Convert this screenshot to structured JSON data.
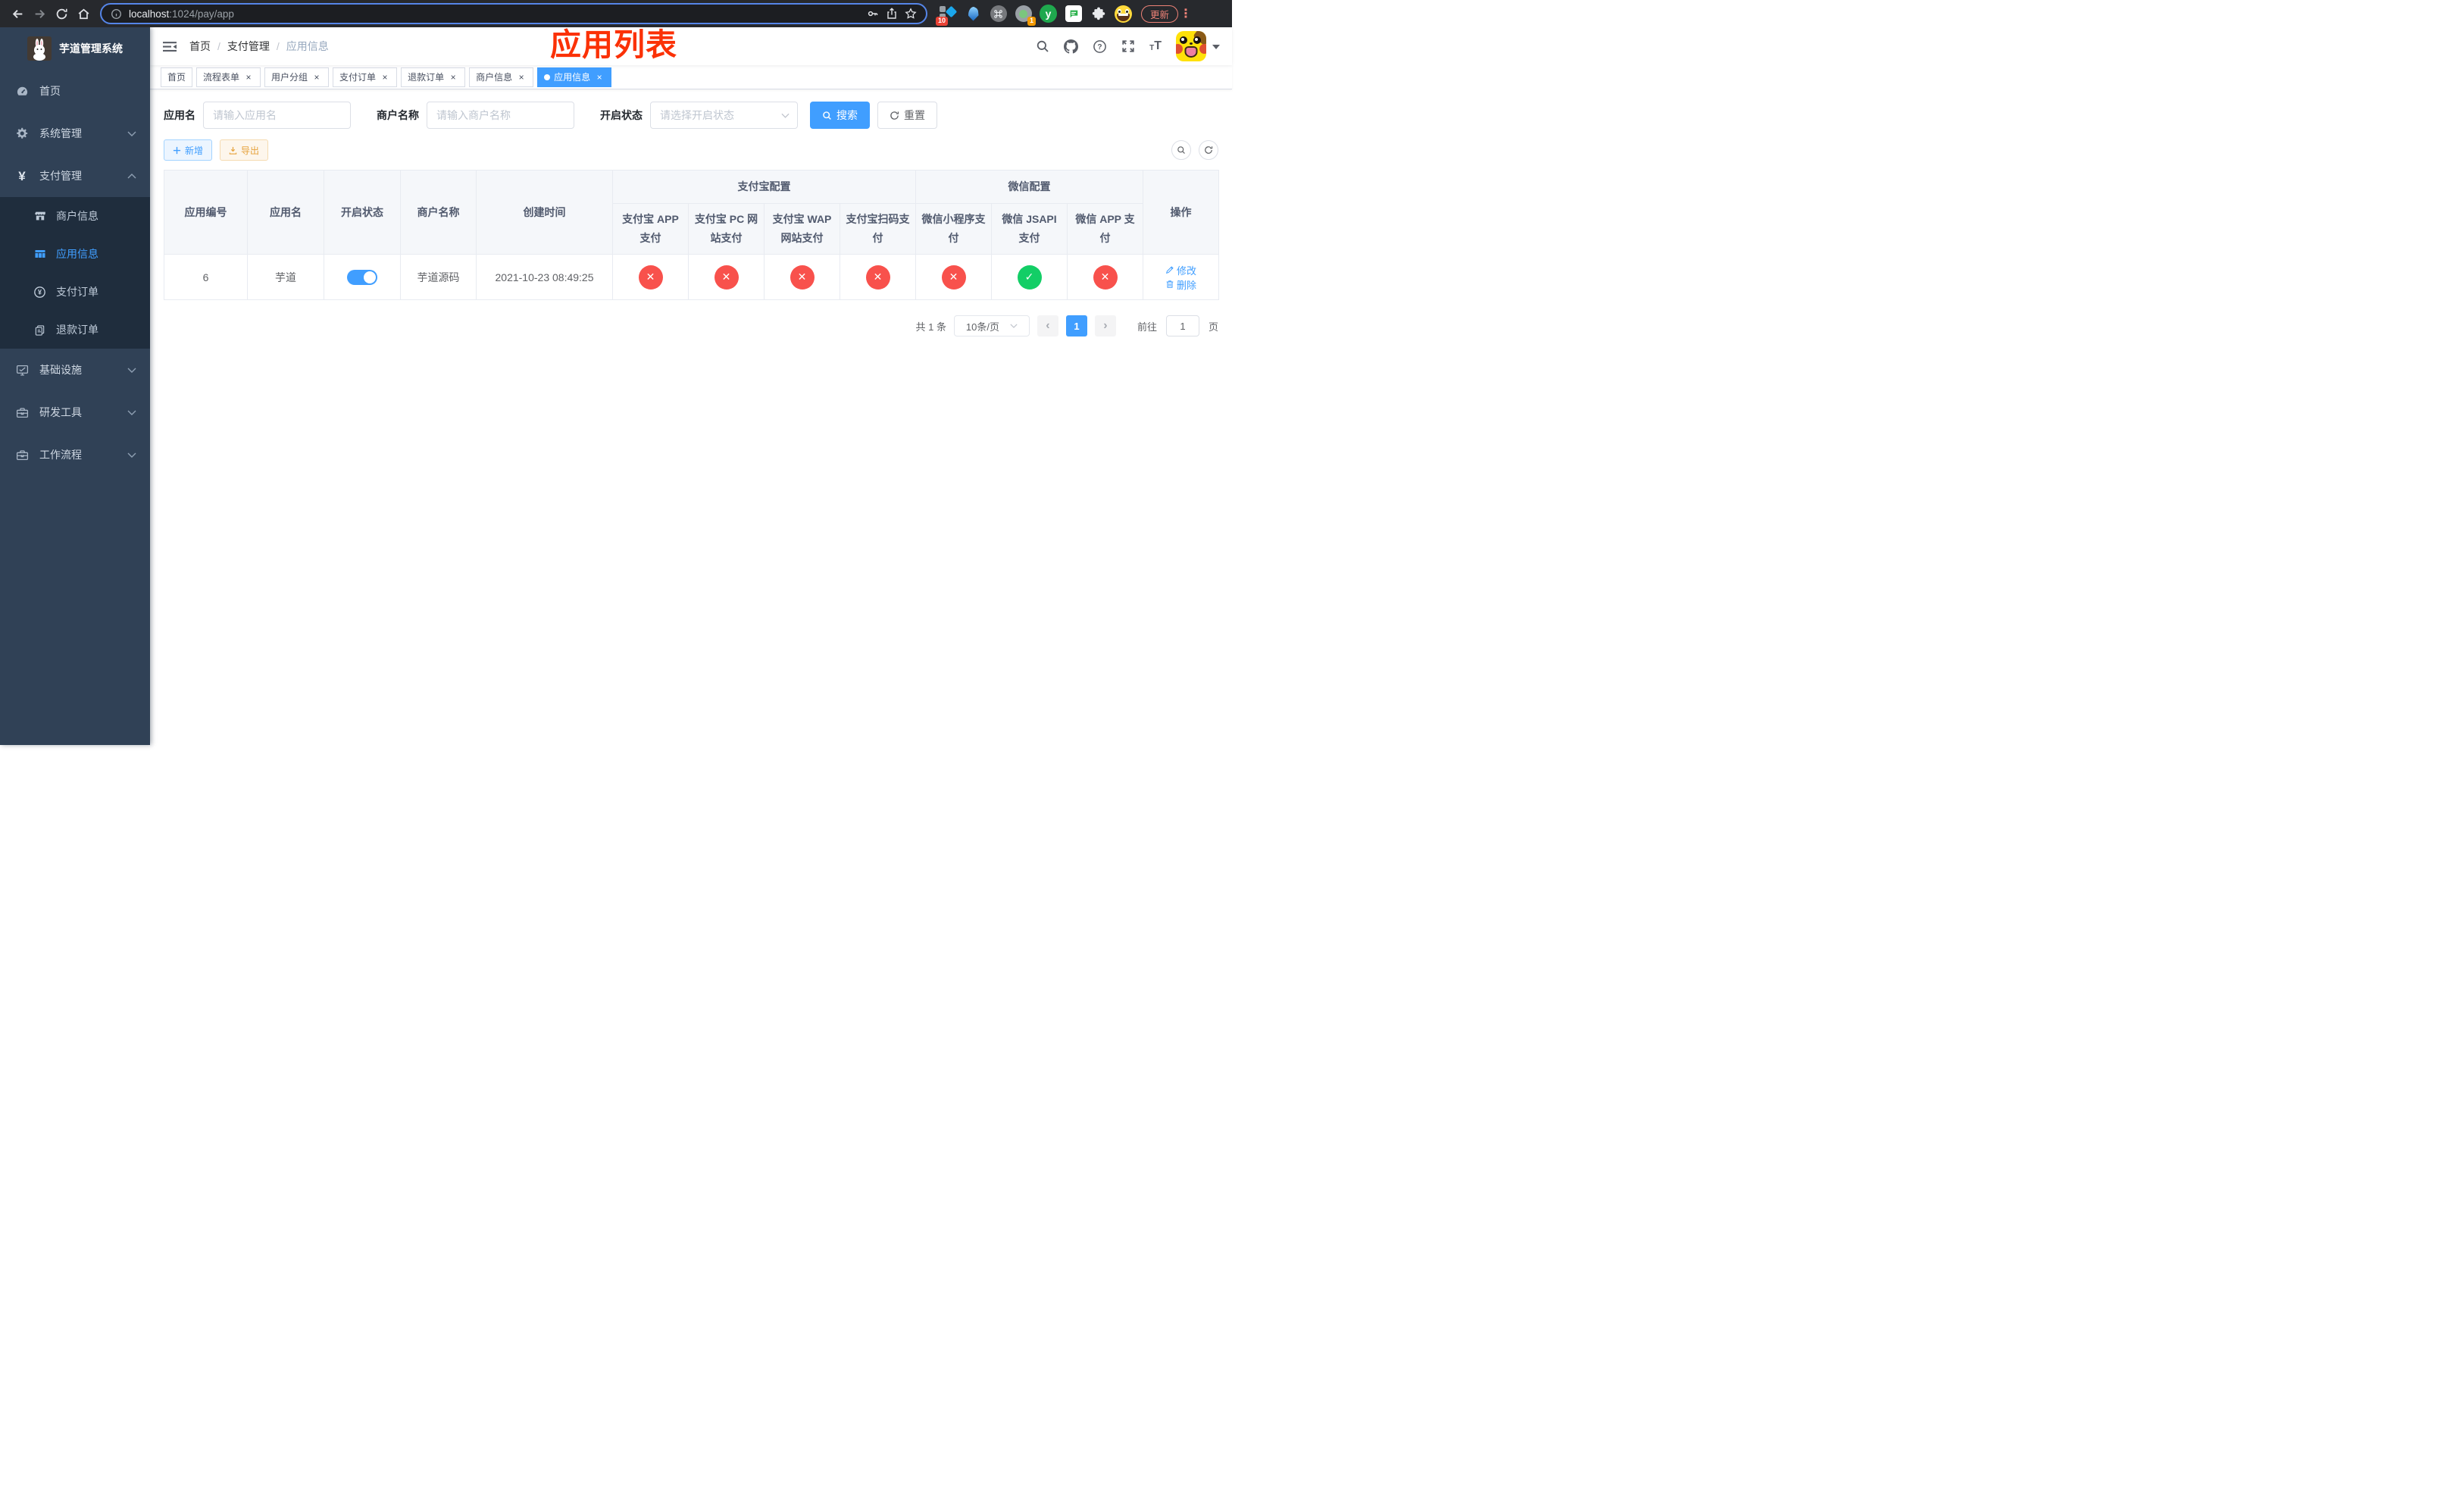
{
  "colors": {
    "accent": "#409eff",
    "danger": "#f8514c",
    "success": "#13ce66",
    "warning": "#e6a23c",
    "annotation_red": "#fb3106",
    "sidebar_bg": "#304156",
    "submenu_bg": "#1f2d3d"
  },
  "browser": {
    "url_host": "localhost",
    "url_path": ":1024/pay/app",
    "update_label": "更新",
    "extension_badges": {
      "first": "10",
      "second": "1"
    },
    "green_ext_letter": "y"
  },
  "sidebar": {
    "title": "芋道管理系统",
    "items": [
      {
        "label": "首页",
        "icon": "dashboard-icon"
      },
      {
        "label": "系统管理",
        "icon": "gear-icon",
        "expandable": true,
        "expanded": false
      },
      {
        "label": "支付管理",
        "icon": "yen-icon",
        "expandable": true,
        "expanded": true
      },
      {
        "label": "基础设施",
        "icon": "monitor-icon",
        "expandable": true,
        "expanded": false
      },
      {
        "label": "研发工具",
        "icon": "toolbox-icon",
        "expandable": true,
        "expanded": false
      },
      {
        "label": "工作流程",
        "icon": "briefcase-icon",
        "expandable": true,
        "expanded": false
      }
    ],
    "payment_children": [
      {
        "label": "商户信息",
        "icon": "shop-icon",
        "active": false
      },
      {
        "label": "应用信息",
        "icon": "grid-icon",
        "active": true
      },
      {
        "label": "支付订单",
        "icon": "yen-circle-icon",
        "active": false
      },
      {
        "label": "退款订单",
        "icon": "document-icon",
        "active": false
      }
    ]
  },
  "navbar": {
    "breadcrumb": [
      "首页",
      "支付管理",
      "应用信息"
    ]
  },
  "overlay_title": "应用列表",
  "tabs": [
    {
      "label": "首页",
      "closable": false,
      "active": false
    },
    {
      "label": "流程表单",
      "closable": true,
      "active": false
    },
    {
      "label": "用户分组",
      "closable": true,
      "active": false
    },
    {
      "label": "支付订单",
      "closable": true,
      "active": false
    },
    {
      "label": "退款订单",
      "closable": true,
      "active": false
    },
    {
      "label": "商户信息",
      "closable": true,
      "active": false
    },
    {
      "label": "应用信息",
      "closable": true,
      "active": true
    }
  ],
  "filters": {
    "app_name": {
      "label": "应用名",
      "placeholder": "请输入应用名",
      "value": ""
    },
    "merchant_name": {
      "label": "商户名称",
      "placeholder": "请输入商户名称",
      "value": ""
    },
    "status": {
      "label": "开启状态",
      "placeholder": "请选择开启状态",
      "value": ""
    },
    "search_label": "搜索",
    "reset_label": "重置"
  },
  "toolbar": {
    "add_label": "新增",
    "export_label": "导出"
  },
  "table": {
    "group_headers": {
      "alipay": "支付宝配置",
      "wechat": "微信配置",
      "operation": "操作"
    },
    "columns": [
      "应用编号",
      "应用名",
      "开启状态",
      "商户名称",
      "创建时间"
    ],
    "channel_headers": [
      "支付宝 APP 支付",
      "支付宝 PC 网站支付",
      "支付宝 WAP 网站支付",
      "支付宝扫码支付",
      "微信小程序支付",
      "微信 JSAPI 支付",
      "微信 APP 支付"
    ],
    "row": {
      "id": "6",
      "name": "芋道",
      "enabled": true,
      "merchant": "芋道源码",
      "created_at": "2021-10-23 08:49:25",
      "channel_status": [
        false,
        false,
        false,
        false,
        false,
        true,
        false
      ],
      "edit_label": "修改",
      "delete_label": "删除"
    }
  },
  "pagination": {
    "total": "共 1 条",
    "page_size": "10条/页",
    "current_page": "1",
    "goto_label": "前往",
    "goto_value": "1",
    "page_unit": "页"
  }
}
